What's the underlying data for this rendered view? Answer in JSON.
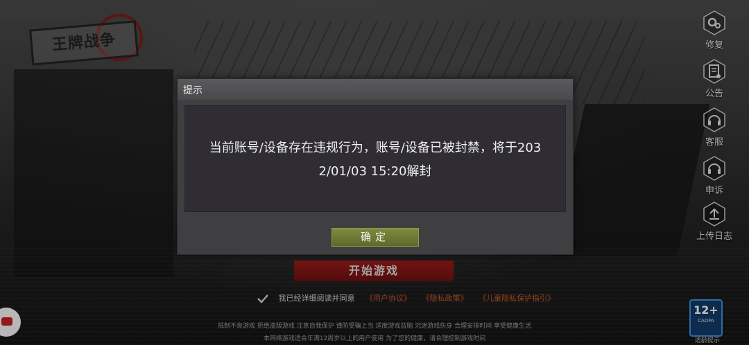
{
  "brand": {
    "logo_text": "王牌战争"
  },
  "side_menu": {
    "items": [
      {
        "label": "修复",
        "icon": "gear-icon"
      },
      {
        "label": "公告",
        "icon": "notice-icon"
      },
      {
        "label": "客服",
        "icon": "headset-icon"
      },
      {
        "label": "申诉",
        "icon": "headset-icon"
      },
      {
        "label": "上传日志",
        "icon": "upload-icon"
      }
    ]
  },
  "start": {
    "button_label": "开始游戏"
  },
  "agreement": {
    "text": "我已经详细阅读并同意",
    "link_user": "《用户协议》",
    "link_privacy": "《隐私政策》",
    "link_children": "《儿童隐私保护指引》"
  },
  "footer": {
    "line1": "抵制不良游戏 拒绝盗版游戏 注意自我保护 谨防受骗上当 适度游戏益脑 沉迷游戏伤身 合理安排时间 享受健康生活",
    "line2": "本网络游戏适合年满12周岁以上的用户使用 为了您的健康，请合理控制游戏时间"
  },
  "age_rating": {
    "badge": "12+",
    "org": "CADPA",
    "tip": "适龄提示"
  },
  "dialog": {
    "title": "提示",
    "message_line1": "当前账号/设备存在违规行为，账号/设备已被封禁，将于203",
    "message_line2": "2/01/03 15:20解封",
    "ok_label": "确定"
  },
  "colors": {
    "ok_button": "#6f7c34",
    "start_button": "#8a1616",
    "link": "#c85a2a",
    "age_badge": "#123a66"
  }
}
